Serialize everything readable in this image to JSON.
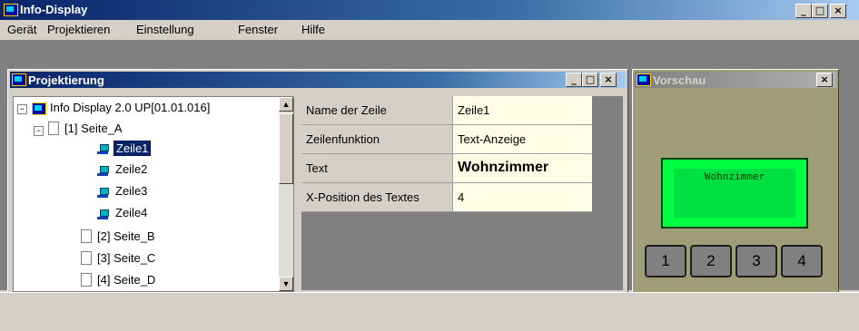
{
  "app": {
    "title": "Info-Display"
  },
  "menu": [
    "Gerät",
    "Projektieren",
    "Einstellung",
    "Fenster",
    "Hilfe"
  ],
  "window_buttons": {
    "minimize": "_",
    "maximize": "□",
    "close": "×"
  },
  "projektierung": {
    "title": "Projektierung",
    "tree": {
      "root": "Info Display 2.0 UP[01.01.016]",
      "page_a": "[1] Seite_A",
      "lines": [
        "Zeile1",
        "Zeile2",
        "Zeile3",
        "Zeile4"
      ],
      "page_b": "[2] Seite_B",
      "page_c": "[3] Seite_C",
      "page_d": "[4] Seite_D"
    },
    "properties": [
      {
        "key": "Name der Zeile",
        "value": "Zeile1"
      },
      {
        "key": "Zeilenfunktion",
        "value": "Text-Anzeige"
      },
      {
        "key": "Text",
        "value": "Wohnzimmer"
      },
      {
        "key": "X-Position des Textes",
        "value": "4"
      }
    ]
  },
  "vorschau": {
    "title": "Vorschau",
    "display_text": "Wohnzimmer",
    "buttons": [
      "1",
      "2",
      "3",
      "4"
    ]
  },
  "colors": {
    "title_active": "#0a246a",
    "title_inactive": "#808080",
    "lcd": "#00ff40",
    "selection": "#0a246a"
  }
}
